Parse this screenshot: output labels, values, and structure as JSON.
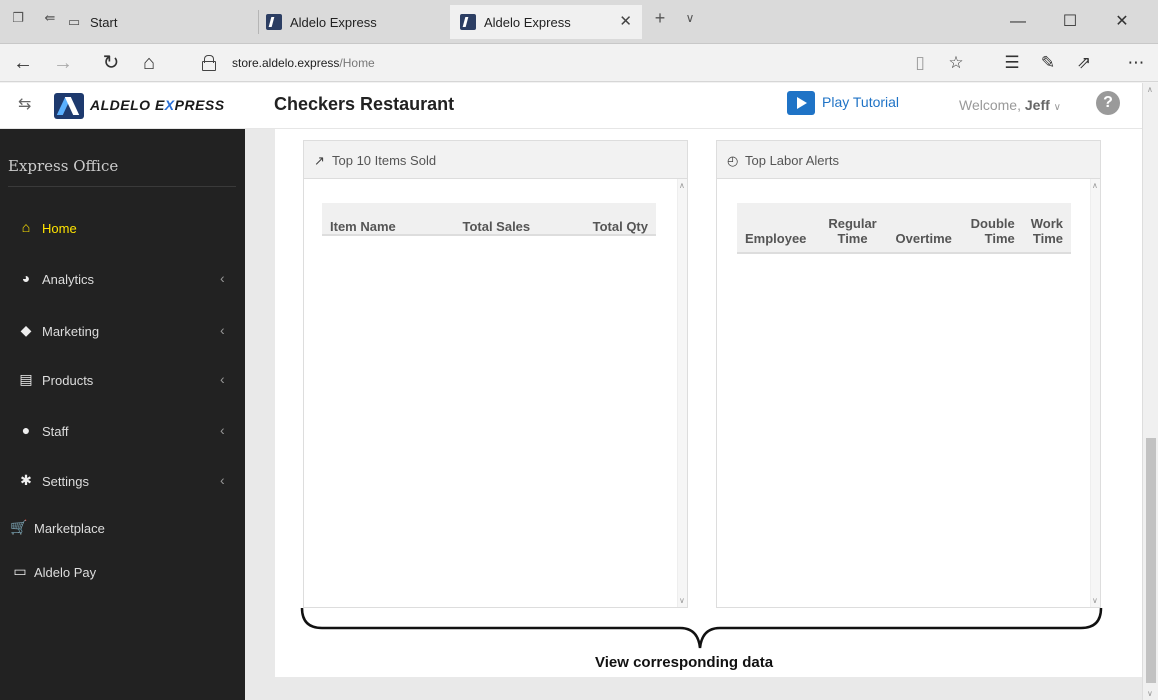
{
  "browser": {
    "tabs": [
      {
        "label": "Start",
        "active": false
      },
      {
        "label": "Aldelo Express",
        "active": false
      },
      {
        "label": "Aldelo Express",
        "active": true
      }
    ],
    "url_host": "store.aldelo.express",
    "url_path": "/Home",
    "icons": {
      "back": "back-arrow-icon",
      "forward": "forward-arrow-icon",
      "refresh": "refresh-icon",
      "home": "home-icon",
      "reading": "reading-view-icon",
      "favorite": "star-icon",
      "favorites_list": "favorites-list-icon",
      "pen": "pen-icon",
      "share": "share-icon",
      "more": "more-icon"
    }
  },
  "header": {
    "logo_text_a": "ALDELO E",
    "logo_text_x": "X",
    "logo_text_b": "PRESS",
    "store_name": "Checkers Restaurant",
    "tutorial_label": "Play Tutorial",
    "welcome_prefix": "Welcome,",
    "user_name": "Jeff",
    "help_label": "?"
  },
  "sidebar": {
    "title": "Express Office",
    "items": [
      {
        "label": "Home",
        "icon": "home-icon",
        "active": true,
        "has_submenu": false
      },
      {
        "label": "Analytics",
        "icon": "pie-chart-icon",
        "active": false,
        "has_submenu": true
      },
      {
        "label": "Marketing",
        "icon": "tag-icon",
        "active": false,
        "has_submenu": true
      },
      {
        "label": "Products",
        "icon": "clipboard-icon",
        "active": false,
        "has_submenu": true
      },
      {
        "label": "Staff",
        "icon": "user-icon",
        "active": false,
        "has_submenu": true
      },
      {
        "label": "Settings",
        "icon": "gear-icon",
        "active": false,
        "has_submenu": true
      },
      {
        "label": "Marketplace",
        "icon": "cart-icon",
        "active": false,
        "has_submenu": false
      },
      {
        "label": "Aldelo Pay",
        "icon": "credit-card-icon",
        "active": false,
        "has_submenu": false
      }
    ]
  },
  "panels": {
    "items_sold": {
      "title": "Top 10 Items Sold",
      "icon": "trend-icon",
      "columns": [
        "Item Name",
        "Total Sales",
        "Total Qty"
      ],
      "rows": []
    },
    "labor_alerts": {
      "title": "Top Labor Alerts",
      "icon": "clock-icon",
      "columns": [
        "Employee",
        "Regular Time",
        "Overtime",
        "Double Time",
        "Work Time"
      ],
      "rows": []
    }
  },
  "annotation": {
    "caption": "View corresponding data"
  },
  "colors": {
    "accent": "#1f73c6",
    "sidebar_bg": "#222222",
    "active_nav": "#ffe400"
  }
}
